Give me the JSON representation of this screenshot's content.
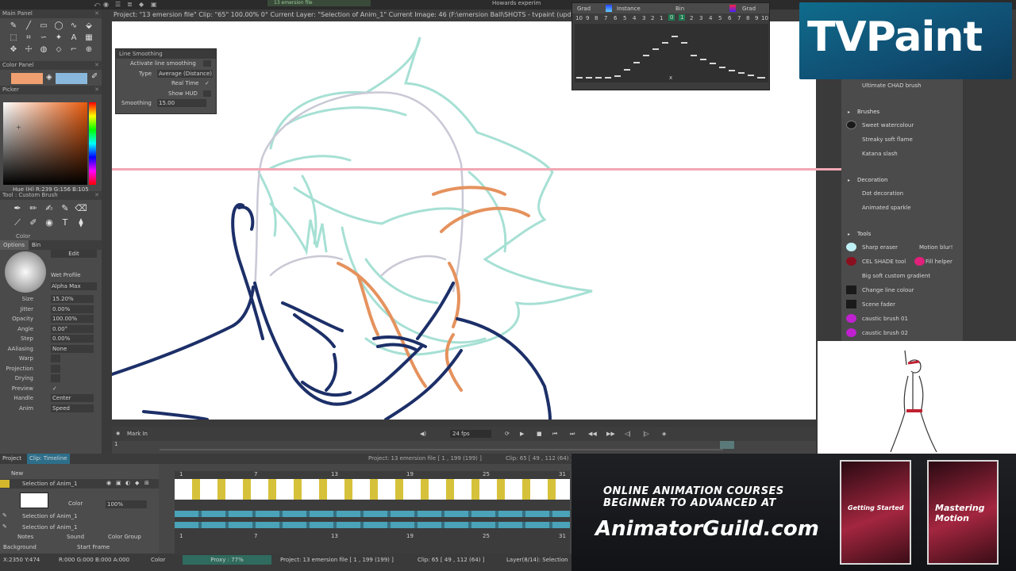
{
  "infobar": {
    "text": "Project: \"13 emersion file\"   Clip: \"65\"   100.00%   0°   Current Layer: \"Selection of Anim_1\"   Current Image: 46 (F:\\emersion Ball\\SHOTS - tvpaint (updated 3)\\13 e"
  },
  "top_title": "Howards experim",
  "top_dropdown": "13 emersion file",
  "left": {
    "main_panel": "Main Panel",
    "color_panel": "Color Panel",
    "picker": "Picker",
    "hue_readout": "Hue (H) R:239 G:156 B:105",
    "tool_custom_brush": "Tool : Custom Brush",
    "color_label": "Color",
    "tab_options": "Options",
    "tab_bin": "Bin",
    "edit": "Edit",
    "wet_profile": "Wet Profile",
    "alpha_max": "Alpha Max",
    "props": [
      {
        "label": "Size",
        "value": "15.20%"
      },
      {
        "label": "Jitter",
        "value": "0.00%"
      },
      {
        "label": "Opacity",
        "value": "100.00%"
      },
      {
        "label": "Angle",
        "value": "0.00°"
      },
      {
        "label": "Step",
        "value": "0.00%"
      },
      {
        "label": "AAliasing",
        "value": "None"
      },
      {
        "label": "Warp",
        "value": ""
      },
      {
        "label": "Projection",
        "value": ""
      },
      {
        "label": "Drying",
        "value": ""
      },
      {
        "label": "Preview",
        "value": "✓"
      },
      {
        "label": "Handle",
        "value": "Center"
      },
      {
        "label": "Anim",
        "value": "Speed"
      }
    ],
    "swatch_a": "#f0a070",
    "swatch_b": "#8ab8dc"
  },
  "line_smoothing": {
    "title": "Line Smoothing",
    "activate": "Activate line smoothing",
    "type_label": "Type",
    "type_value": "Average (Distance)",
    "real_time": "Real Time",
    "real_time_check": "✓",
    "show_hud": "Show HUD",
    "smoothing_label": "Smoothing",
    "smoothing_value": "15.00"
  },
  "grad": {
    "tab1": "Grad",
    "tab2": "Instance",
    "tab3": "Bin",
    "tab4": "Grad",
    "left_nums": [
      "10",
      "9",
      "8",
      "7",
      "6",
      "5",
      "4",
      "3",
      "2",
      "1"
    ],
    "mid_nums": [
      "0",
      "1"
    ],
    "right_nums": [
      "2",
      "3",
      "4",
      "5",
      "6",
      "7",
      "8",
      "9",
      "10"
    ],
    "x_label": "x"
  },
  "logo": {
    "text": "TVPaint"
  },
  "presets": {
    "top_item": "Ultimate CHAD brush",
    "brushes_header": "Brushes",
    "brushes": [
      "Sweet watercolour",
      "Streaky soft flame",
      "Katana slash"
    ],
    "decoration_header": "Decoration",
    "decoration": [
      "Dot decoration",
      "Animated sparkle"
    ],
    "tools_header": "Tools",
    "tools": [
      [
        "Sharp eraser",
        "Motion blur!"
      ],
      [
        "CEL SHADE tool",
        "Fill helper"
      ],
      [
        "Big soft custom gradient",
        ""
      ],
      [
        "Change line colour",
        ""
      ],
      [
        "Scene fader",
        ""
      ],
      [
        "caustic brush 01",
        ""
      ],
      [
        "caustic brush 02",
        ""
      ]
    ]
  },
  "transport": {
    "mark_in": "Mark In",
    "fps": "24 fps",
    "start_frame": "1"
  },
  "timeline": {
    "tab_project": "Project",
    "tab_clip": "Clip: Timeline",
    "project_info": "Project: 13 emersion file [ 1 , 199  (199) ]",
    "clip_info": "Clip: 65 [ 49 , 112  (64) ]",
    "new_label": "New",
    "layers": [
      "Selection of Anim_1",
      "Selection of Anim_1",
      "Selection of Anim_1"
    ],
    "color_label": "Color",
    "opacity": "100%",
    "notes": "Notes",
    "sound": "Sound",
    "color_group": "Color Group",
    "background": "Background",
    "start_frame": "Start Frame",
    "ruler": [
      "1",
      "7",
      "13",
      "19",
      "25",
      "31"
    ]
  },
  "status": {
    "coords": "X:2350  Y:474",
    "rgba": "R:000 G:000 B:000 A:000",
    "color": "Color",
    "proxy": "Proxy : 77%",
    "project": "Project: 13 emersion file [ 1 , 199  (199) ]",
    "clip": "Clip: 65 [ 49 , 112  (64) ]",
    "layer": "Layer(8/14): Selection"
  },
  "ad": {
    "line1": "ONLINE ANIMATION COURSES",
    "line2": "BEGINNER TO ADVANCED AT",
    "site": "AnimatorGuild.com",
    "box1": "Getting Started",
    "box2": "Mastering Motion"
  }
}
